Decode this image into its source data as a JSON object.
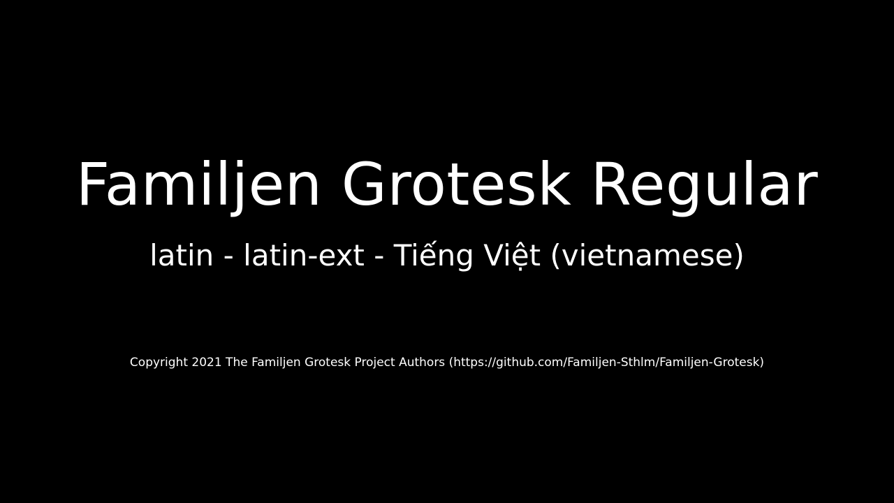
{
  "title": "Familjen Grotesk Regular",
  "subtitle": "latin - latin-ext - Tiếng Việt (vietnamese)",
  "copyright": "Copyright 2021 The Familjen Grotesk Project Authors (https://github.com/Familjen-Sthlm/Familjen-Grotesk)",
  "colors": {
    "background": "#000000",
    "text": "#ffffff"
  }
}
